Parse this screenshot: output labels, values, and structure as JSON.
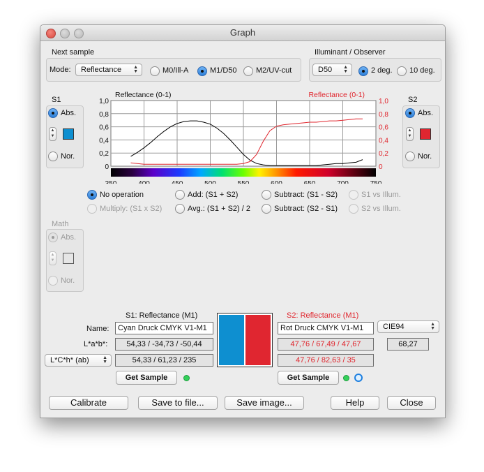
{
  "window": {
    "title": "Graph"
  },
  "next_sample": {
    "group_label": "Next sample",
    "mode_label": "Mode:",
    "mode_value": "Reflectance",
    "options": [
      "M0/Ill-A",
      "M1/D50",
      "M2/UV-cut"
    ],
    "selected": "M1/D50"
  },
  "illuminant": {
    "group_label": "Illuminant / Observer",
    "value": "D50",
    "observers": [
      "2 deg.",
      "10 deg."
    ],
    "selected": "2 deg."
  },
  "s1": {
    "label": "S1",
    "abs_label": "Abs.",
    "nor_label": "Nor.",
    "selected": "Abs.",
    "color": "#0e8fd0"
  },
  "s2": {
    "label": "S2",
    "abs_label": "Abs.",
    "nor_label": "Nor.",
    "selected": "Abs.",
    "color": "#e02630"
  },
  "math": {
    "label": "Math",
    "abs_label": "Abs.",
    "nor_label": "Nor."
  },
  "operations": {
    "no_op": "No operation",
    "add": "Add: (S1 + S2)",
    "sub1": "Subtract: (S1 - S2)",
    "s1_illum": "S1 vs Illum.",
    "multiply": "Multiply: (S1 x S2)",
    "avg": "Avg.: (S1 + S2) / 2",
    "sub2": "Subtract: (S2 - S1)",
    "s2_illum": "S2 vs Illum.",
    "selected": "No operation"
  },
  "chart_data": {
    "type": "line",
    "left_ylabel": "Reflectance (0-1)",
    "right_ylabel": "Reflectance (0-1)",
    "xlim": [
      350,
      750
    ],
    "ylim": [
      0,
      1
    ],
    "x_ticks": [
      "350",
      "400",
      "450",
      "500",
      "550",
      "600",
      "650",
      "700",
      "750"
    ],
    "y_ticks_left": [
      "0",
      "0,2",
      "0,4",
      "0,6",
      "0,8",
      "1,0"
    ],
    "y_ticks_right": [
      "0",
      "0,2",
      "0,4",
      "0,6",
      "0,8",
      "1,0"
    ],
    "grid": true,
    "series": [
      {
        "color": "#000000",
        "x": [
          380,
          390,
          400,
          410,
          420,
          430,
          440,
          450,
          460,
          470,
          480,
          490,
          500,
          510,
          520,
          530,
          540,
          550,
          560,
          570,
          580,
          590,
          600,
          610,
          620,
          630,
          640,
          650,
          660,
          670,
          680,
          690,
          700,
          710,
          720,
          730
        ],
        "y": [
          0.15,
          0.21,
          0.28,
          0.36,
          0.45,
          0.53,
          0.6,
          0.65,
          0.68,
          0.69,
          0.69,
          0.67,
          0.64,
          0.58,
          0.5,
          0.4,
          0.29,
          0.18,
          0.09,
          0.04,
          0.02,
          0.01,
          0.01,
          0.01,
          0.01,
          0.01,
          0.01,
          0.01,
          0.01,
          0.02,
          0.03,
          0.04,
          0.04,
          0.05,
          0.06,
          0.1
        ]
      },
      {
        "color": "#e0262e",
        "x": [
          380,
          390,
          400,
          410,
          420,
          430,
          440,
          450,
          460,
          470,
          480,
          490,
          500,
          510,
          520,
          530,
          540,
          550,
          560,
          570,
          580,
          590,
          600,
          610,
          620,
          630,
          640,
          650,
          660,
          670,
          680,
          690,
          700,
          710,
          720,
          730
        ],
        "y": [
          0.05,
          0.04,
          0.03,
          0.03,
          0.03,
          0.03,
          0.03,
          0.03,
          0.03,
          0.03,
          0.03,
          0.03,
          0.03,
          0.03,
          0.03,
          0.03,
          0.03,
          0.04,
          0.07,
          0.18,
          0.38,
          0.54,
          0.61,
          0.63,
          0.64,
          0.65,
          0.66,
          0.67,
          0.67,
          0.68,
          0.69,
          0.69,
          0.7,
          0.71,
          0.72,
          0.72
        ]
      }
    ]
  },
  "sample1": {
    "header": "S1: Reflectance (M1)",
    "name_label": "Name:",
    "name": "Cyan Druck CMYK V1-M1",
    "lab_label": "L*a*b*:",
    "lab": "54,33 / -34,73 / -50,44",
    "lch_select": "L*C*h* (ab)",
    "lch": "54,33 / 61,23 / 235",
    "button": "Get Sample",
    "color": "#0e8fd0"
  },
  "sample2": {
    "header": "S2: Reflectance (M1)",
    "name": "Rot Druck CMYK V1-M1",
    "lab": "47,76 / 67,49 / 47,67",
    "lch": "47,76 / 82,63 / 35",
    "button": "Get Sample",
    "color": "#e02630"
  },
  "delta": {
    "formula": "CIE94",
    "value": "68,27"
  },
  "buttons": {
    "calibrate": "Calibrate",
    "save_file": "Save to file...",
    "save_image": "Save image...",
    "help": "Help",
    "close": "Close"
  }
}
